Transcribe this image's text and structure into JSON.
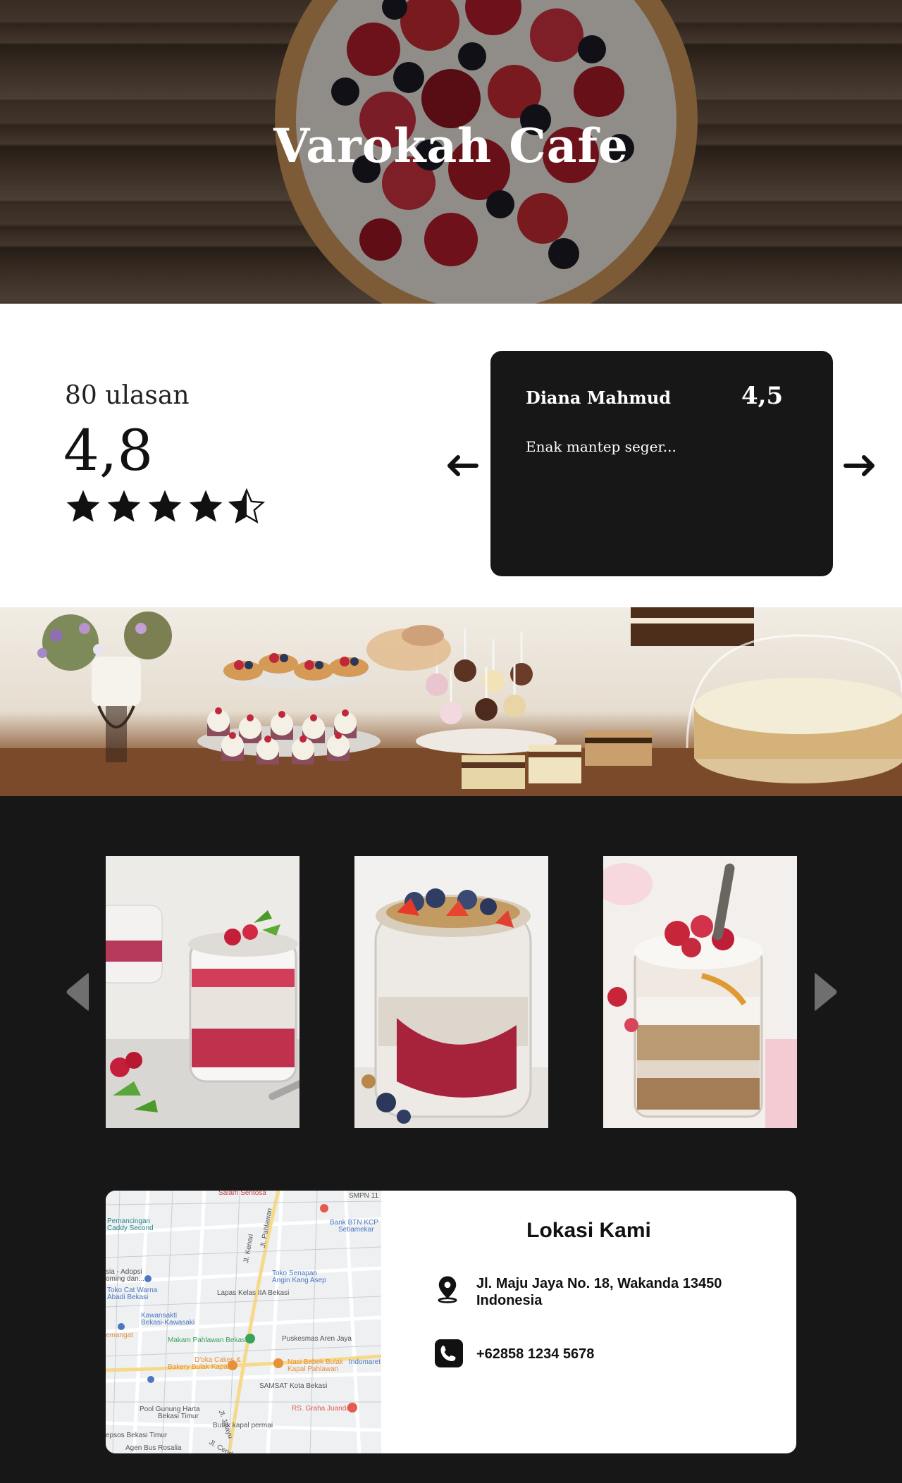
{
  "hero": {
    "title": "Varokah Cafe"
  },
  "rating_summary": {
    "count_label": "80 ulasan",
    "score": "4,8",
    "stars": 4.5
  },
  "review": {
    "name": "Diana Mahmud",
    "rating": "4,5",
    "text": "Enak mantep seger..."
  },
  "location": {
    "title": "Lokasi Kami",
    "address_line1": "Jl. Maju Jaya No. 18, Wakanda 13450",
    "address_line2": "Indonesia",
    "phone": "+62858 1234 5678",
    "map_labels": [
      "Salam Sentosa",
      "SMPN 11",
      "Pemancingan",
      "Caddy Second",
      "Bank BTN KCP",
      "Setiamekar",
      "Toko Senapan",
      "Angin Kang Asep",
      "sia - Adopsi",
      "oming dan...",
      "Toko Cat Warna",
      "Abadi Bekasi",
      "Lapas Kelas IIA Bekasi",
      "Kawansakti",
      "Bekasi-Kawasaki",
      "emangat",
      "Makam Pahlawan Bekasi",
      "Puskesmas Aren Jaya",
      "D'oka Cakes &",
      "Bakery Bulak Kapal",
      "Nasi Bebek Bulak",
      "Kapal Pahlawan",
      "Indomaret",
      "SAMSAT Kota Bekasi",
      "Pool Gunung Harta",
      "Bekasi Timur",
      "RS. Graha Juanda",
      "Bulak kapal permai",
      "epsos Bekasi Timur",
      "Agen Bus Rosalia",
      "Jl. Pahlawan",
      "Jl. Kenari",
      "Jl. Jatayu",
      "Jl. Cendr"
    ]
  },
  "colors": {
    "dark": "#171717",
    "white": "#ffffff",
    "accent_red": "#c62a3a"
  }
}
